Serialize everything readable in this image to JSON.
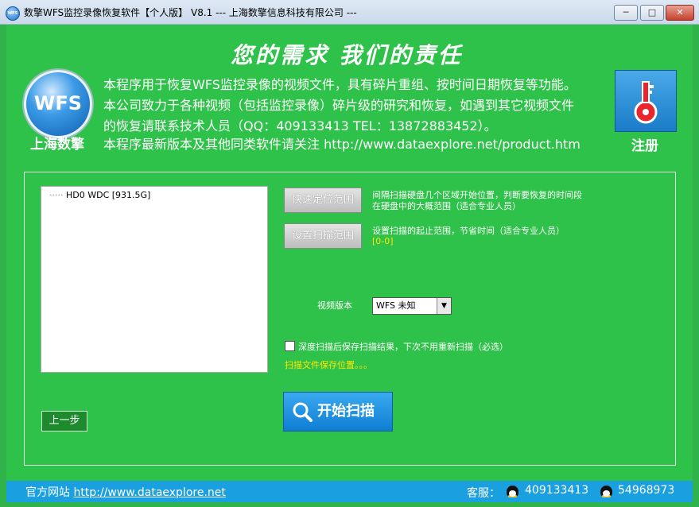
{
  "window": {
    "title": "数擎WFS监控录像恢复软件【个人版】 V8.1   --- 上海数擎信息科技有限公司 ---",
    "icon": "wfs-app-icon",
    "controls": {
      "minimize": "─",
      "maximize": "□",
      "close": "✕"
    }
  },
  "header": {
    "slogan": "您的需求   我们的责任",
    "logo_text": "WFS",
    "company": "上海数擎",
    "description": [
      "本程序用于恢复WFS监控录像的视频文件，具有碎片重组、按时间日期恢复等功能。",
      "本公司致力于各种视频（包括监控录像）碎片级的研究和恢复，如遇到其它视频文件",
      "的恢复请联系技术人员（QQ：409133413  TEL：13872883452）。",
      "本程序最新版本及其他同类软件请关注 http://www.dataexplore.net/product.htm"
    ],
    "register_label": "注册",
    "register_icon": "key-icon"
  },
  "disk_tree": {
    "items": [
      {
        "prefix": "·····",
        "label": "HD0   WDC  [931.5G]"
      }
    ]
  },
  "actions": {
    "quick_locate_label": "快速定位范围",
    "quick_locate_hint_1": "间隔扫描硬盘几个区域开始位置，判断要恢复的时间段",
    "quick_locate_hint_2": "在硬盘中的大概范围（适合专业人员）",
    "set_range_label": "设置扫描范围",
    "set_range_hint": "设置扫描的起止范围，节省时间（适合专业人员）",
    "range_value": "[0-0]"
  },
  "video_version": {
    "label": "视频版本",
    "selected": "WFS 未知"
  },
  "deep_scan": {
    "checked": false,
    "label": "深度扫描后保存扫描结果，下次不用重新扫描（必选）",
    "save_location": "扫描文件保存位置。。。"
  },
  "start_button": {
    "label": "开始扫描",
    "icon": "search-icon"
  },
  "prev_button": {
    "label": "上一步"
  },
  "footer": {
    "official_prefix": "官方网站",
    "official_url": "http://www.dataexplore.net",
    "service_label": "客服：",
    "qq1": "409133413",
    "qq2": "54968973"
  },
  "colors": {
    "background": "#2fc24a",
    "accent_blue": "#1aa0e0",
    "highlight_yellow": "#ffe600"
  }
}
